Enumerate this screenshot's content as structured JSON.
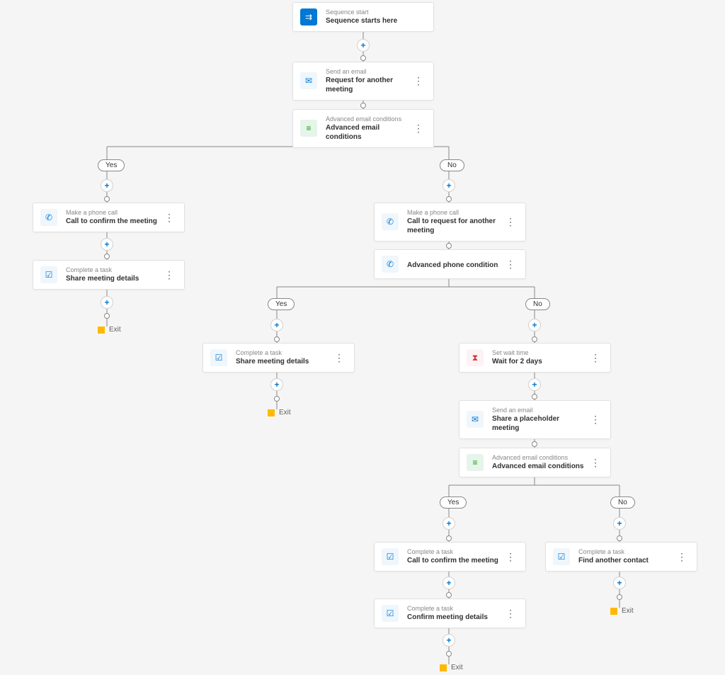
{
  "labels": {
    "yes": "Yes",
    "no": "No",
    "exit": "Exit"
  },
  "nodes": {
    "n1": {
      "type": "Sequence start",
      "title": "Sequence starts here"
    },
    "n2": {
      "type": "Send an email",
      "title": "Request for another meeting"
    },
    "n3": {
      "type": "Advanced email conditions",
      "title": "Advanced email conditions"
    },
    "n4": {
      "type": "Make a phone call",
      "title": "Call to confirm the meeting"
    },
    "n5": {
      "type": "Complete a task",
      "title": "Share meeting details"
    },
    "n6": {
      "type": "Make a phone call",
      "title": "Call to request for another meeting"
    },
    "n7": {
      "type": "",
      "title": "Advanced phone condition"
    },
    "n8": {
      "type": "Complete a task",
      "title": "Share meeting details"
    },
    "n9": {
      "type": "Set wait time",
      "title": "Wait for 2 days"
    },
    "n10": {
      "type": "Send an email",
      "title": "Share a placeholder meeting"
    },
    "n11": {
      "type": "Advanced email conditions",
      "title": "Advanced email conditions"
    },
    "n12": {
      "type": "Complete a task",
      "title": "Call to confirm the meeting"
    },
    "n13": {
      "type": "Complete a task",
      "title": "Confirm meeting details"
    },
    "n14": {
      "type": "Complete a task",
      "title": "Find another contact"
    }
  }
}
